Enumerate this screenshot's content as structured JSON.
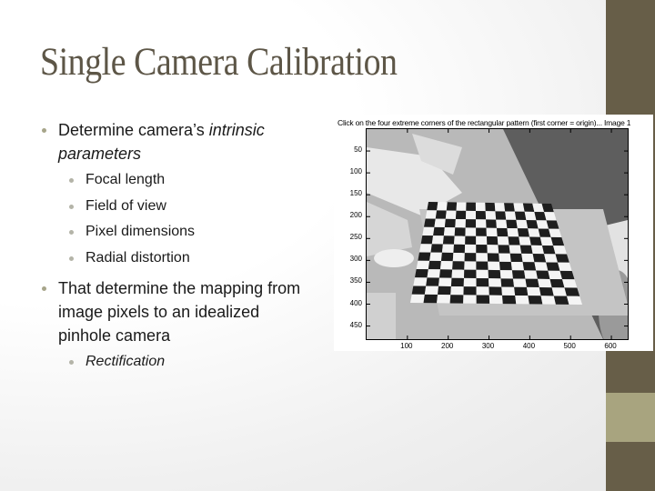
{
  "slide": {
    "title": "Single Camera Calibration",
    "bullets": [
      {
        "level": 1,
        "parts": [
          {
            "text": "Determine camera’s ",
            "italic": false
          },
          {
            "text": "intrinsic parameters",
            "italic": true
          }
        ]
      },
      {
        "level": 2,
        "text": "Focal length"
      },
      {
        "level": 2,
        "text": "Field of view"
      },
      {
        "level": 2,
        "text": "Pixel dimensions"
      },
      {
        "level": 2,
        "text": "Radial distortion"
      },
      {
        "level": 1,
        "text": "That determine the mapping from image pixels to an idealized pinhole camera"
      },
      {
        "level": 2,
        "text": "Rectification",
        "italic": true
      }
    ]
  },
  "theme": {
    "title_color": "#5d5647",
    "sidebar_color": "#675e48",
    "sidebar_band_color": "#a8a47f",
    "bullet_color": "#a7a58a"
  },
  "figure": {
    "title": "Click on the four extreme corners of the rectangular pattern (first corner = origin)... Image 1",
    "image_description": "grayscale photo of a checkerboard calibration pattern on a desk",
    "x_ticks": [
      "100",
      "200",
      "300",
      "400",
      "500",
      "600"
    ],
    "y_ticks": [
      "50",
      "100",
      "150",
      "200",
      "250",
      "300",
      "350",
      "400",
      "450"
    ],
    "x_range": [
      0,
      640
    ],
    "y_range": [
      0,
      480
    ],
    "checkerboard": {
      "columns": 13,
      "rows": 12
    }
  }
}
